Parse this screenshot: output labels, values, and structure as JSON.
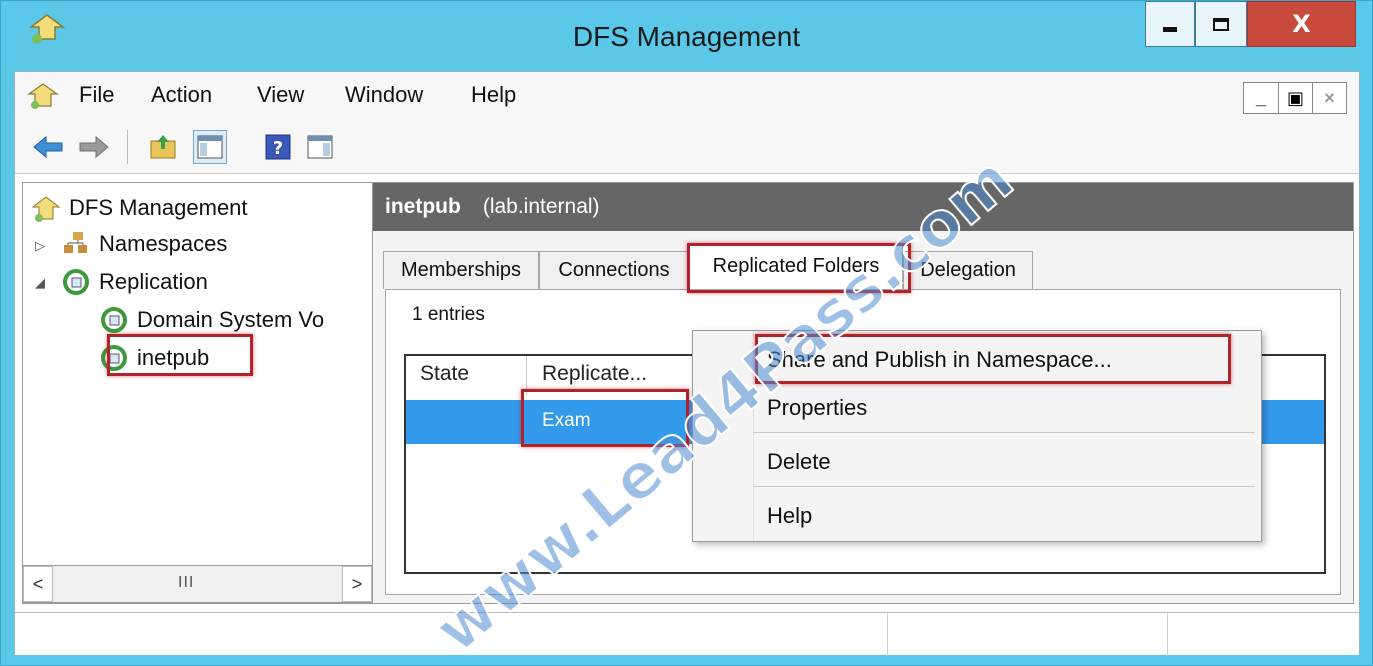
{
  "window": {
    "title": "DFS Management",
    "minimize": "minimize",
    "maximize": "maximize",
    "close": "X"
  },
  "menubar": {
    "items": [
      "File",
      "Action",
      "View",
      "Window",
      "Help"
    ]
  },
  "tree": {
    "root": "DFS Management",
    "namespaces": "Namespaces",
    "replication": "Replication",
    "domain_system": "Domain System Vo",
    "inetpub": "inetpub",
    "scroll_left": "<",
    "scroll_right": ">",
    "scroll_grip": "III"
  },
  "header": {
    "name": "inetpub",
    "domain": "(lab.internal)"
  },
  "tabs": [
    "Memberships",
    "Connections",
    "Replicated Folders",
    "Delegation"
  ],
  "list": {
    "entries": "1 entries",
    "col_state": "State",
    "col_replicated": "Replicate...",
    "row_folder": "Exam"
  },
  "context_menu": {
    "items": [
      "Share and Publish in Namespace...",
      "Properties",
      "Delete",
      "Help"
    ]
  },
  "watermark": "www.Lead4Pass.com",
  "colors": {
    "title_bar": "#5bc8ea",
    "selection": "#3399ea",
    "highlight": "#b0232b"
  }
}
